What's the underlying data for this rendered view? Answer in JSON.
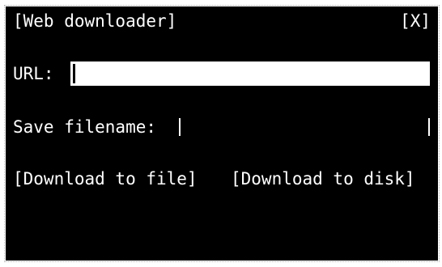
{
  "window": {
    "title": "[Web downloader]",
    "close_label": "[X]"
  },
  "form": {
    "url_label": "URL:",
    "url_value": "",
    "save_label": "Save filename:",
    "save_value": ""
  },
  "actions": {
    "download_file_label": "[Download to file]",
    "download_disk_label": "[Download to disk]"
  },
  "colors": {
    "background": "#000000",
    "foreground": "#ffffff",
    "page": "#ffffff"
  }
}
